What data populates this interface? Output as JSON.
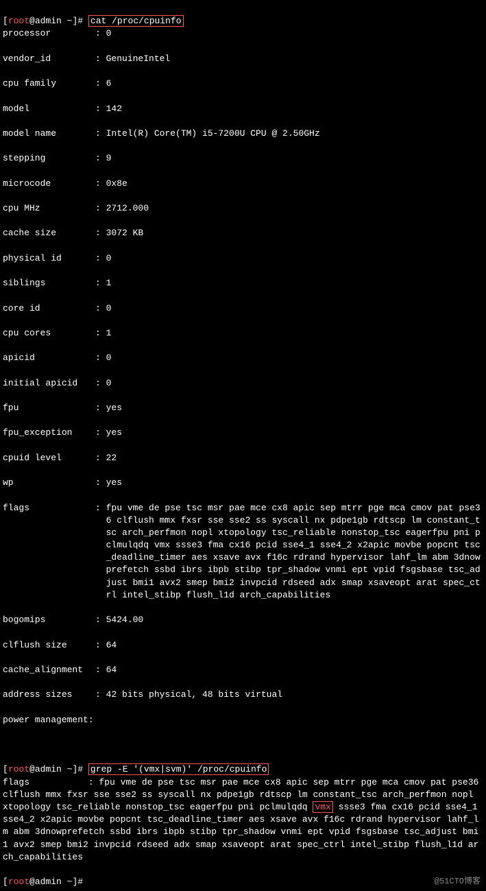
{
  "prompt": {
    "user": "root",
    "at": "@",
    "host": "admin",
    "path": "~",
    "symbol": "#"
  },
  "cmd1": "cat /proc/cpuinfo",
  "cpuinfo": {
    "processor": "0",
    "vendor_id": "GenuineIntel",
    "cpu_family": "6",
    "model": "142",
    "model_name": "Intel(R) Core(TM) i5-7200U CPU @ 2.50GHz",
    "stepping": "9",
    "microcode": "0x8e",
    "cpu_mhz": "2712.000",
    "cache_size": "3072 KB",
    "physical_id": "0",
    "siblings": "1",
    "core_id": "0",
    "cpu_cores": "1",
    "apicid": "0",
    "initial_apicid": "0",
    "fpu": "yes",
    "fpu_exception": "yes",
    "cpuid_level": "22",
    "wp": "yes",
    "flags": "fpu vme de pse tsc msr pae mce cx8 apic sep mtrr pge mca cmov pat pse36 clflush mmx fxsr sse sse2 ss syscall nx pdpe1gb rdtscp lm constant_tsc arch_perfmon nopl xtopology tsc_reliable nonstop_tsc eagerfpu pni pclmulqdq vmx ssse3 fma cx16 pcid sse4_1 sse4_2 x2apic movbe popcnt tsc_deadline_timer aes xsave avx f16c rdrand hypervisor lahf_lm abm 3dnowprefetch ssbd ibrs ibpb stibp tpr_shadow vnmi ept vpid fsgsbase tsc_adjust bmi1 avx2 smep bmi2 invpcid rdseed adx smap xsaveopt arat spec_ctrl intel_stibp flush_l1d arch_capabilities",
    "bogomips": "5424.00",
    "clflush_size": "64",
    "cache_alignment": "64",
    "address_sizes": "42 bits physical, 48 bits virtual",
    "power_management": ""
  },
  "cmd2": "grep -E '(vmx|svm)' /proc/cpuinfo",
  "grep_output": {
    "prefix": "flags           : fpu vme de pse tsc msr pae mce cx8 apic sep mtrr pge mca cmov pat pse36 clflush mmx fxsr sse sse2 ss syscall nx pdpe1gb rdtscp lm constant_tsc arch_perfmon nopl xtopology tsc_reliable nonstop_tsc eagerfpu pni pclmulqdq ",
    "highlight": "vmx",
    "suffix": " ssse3 fma cx16 pcid sse4_1 sse4_2 x2apic movbe popcnt tsc_deadline_timer aes xsave avx f16c rdrand hypervisor lahf_lm abm 3dnowprefetch ssbd ibrs ibpb stibp tpr_shadow vnmi ept vpid fsgsbase tsc_adjust bmi1 avx2 smep bmi2 invpcid rdseed adx smap xsaveopt arat spec_ctrl intel_stibp flush_l1d arch_capabilities"
  },
  "watermark": "@51CTO博客"
}
